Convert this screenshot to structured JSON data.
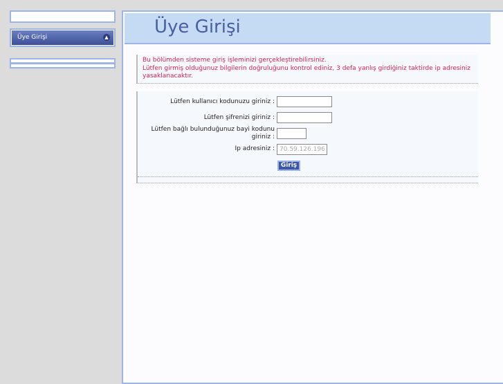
{
  "sidebar": {
    "menu_label": "Üye Girişi",
    "collapse_icon": "chevron-up-icon"
  },
  "header": {
    "title": "Üye Girişi"
  },
  "message": {
    "line1": "Bu bölümden sisteme giriş işleminizi gerçekleştirebilirsiniz.",
    "line2": "Lütfen girmiş olduğunuz bilgilerin doğruluğunu kontrol ediniz, 3 defa yanlış girdiğiniz taktirde ip adresiniz yasaklanacaktır."
  },
  "form": {
    "user_label": "Lütfen kullanıcı kodunuzu giriniz :",
    "user_value": "",
    "password_label": "Lütfen şifrenizi giriniz :",
    "password_value": "",
    "dealer_label": "Lütfen bağlı bulunduğunuz bayi kodunu giriniz :",
    "dealer_value": "",
    "ip_label": "Ip adresiniz :",
    "ip_value": "70.59.126.196",
    "submit_label": "Giriş"
  },
  "colors": {
    "accent": "#3e56a8",
    "border": "#9db4e6",
    "header_bg": "#c5daf3",
    "message": "#e0204f"
  }
}
